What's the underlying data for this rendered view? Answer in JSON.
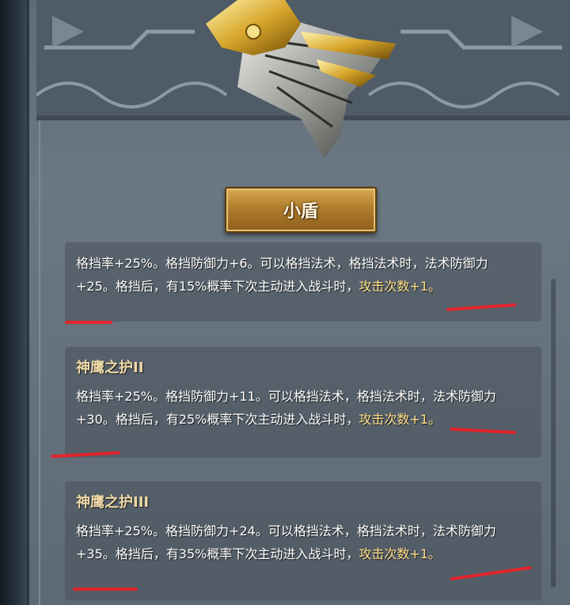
{
  "item": {
    "name": "小盾",
    "icon": "golden-wing-shield-icon"
  },
  "effects": [
    {
      "heading": "",
      "text_main": "格挡率+25%。格挡防御力+6。可以格挡法术，格挡法术时，法术防御力+25。格挡后，有15%概率下次主动进入战斗时，",
      "text_tail": "攻击次数+1。"
    },
    {
      "heading": "神鹰之护II",
      "text_main": "格挡率+25%。格挡防御力+11。可以格挡法术，格挡法术时，法术防御力+30。格挡后，有25%概率下次主动进入战斗时，",
      "text_tail": "攻击次数+1。"
    },
    {
      "heading": "神鹰之护III",
      "text_main": "格挡率+25%。格挡防御力+24。可以格挡法术，格挡法术时，法术防御力+35。格挡后，有35%概率下次主动进入战斗时，",
      "text_tail": "攻击次数+1。"
    }
  ],
  "colors": {
    "panel": "#66727d",
    "heading": "#eed9a6",
    "text": "#ffffff",
    "annotation": "#e0252c",
    "plate": "#b07d2e"
  }
}
